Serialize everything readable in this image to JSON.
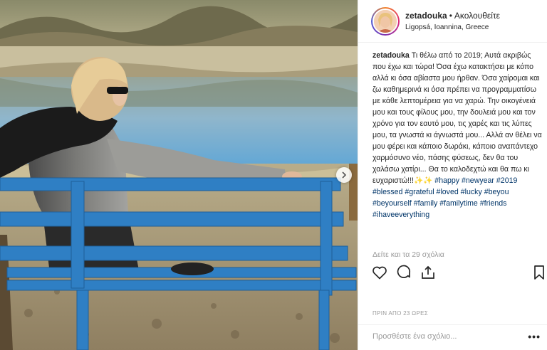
{
  "post": {
    "username": "zetadouka",
    "separator": "•",
    "follow_label": "Ακολουθείτε",
    "location": "Ligopsá, Ioannina, Greece",
    "caption": {
      "username": "zetadouka",
      "text": "Τι θέλω από το 2019; Αυτά ακριβώς που έχω και τώρα! Όσα έχω κατακτήσει με κόπο αλλά κι όσα αβίαστα μου ήρθαν. Όσα χαίρομαι και ζω καθημερινά κι όσα πρέπει να προγραμματίσω με κάθε λεπτομέρεια για να χαρώ. Την οικογένειά μου και τους φίλους μου, την δουλειά μου και τον χρόνο για τον εαυτό μου, τις χαρές και τις λύπες μου, τα γνωστά κι άγνωστά μου... Αλλά αν θέλει να μου φέρει και κάποιο δωράκι, κάποιο αναπάντεχο χαρμόσυνο νέο, πάσης φύσεως, δεν θα του χαλάσω χατίρι... Θα το καλοδεχτώ και θα πω κι ευχαριστώ!!!✨✨ ",
      "hashtags": [
        "#happy",
        "#newyear",
        "#2019",
        "#blessed",
        "#grateful",
        "#loved",
        "#lucky",
        "#beyou",
        "#beyourself",
        "#family",
        "#familytime",
        "#friends",
        "#ihaveeverything"
      ]
    },
    "view_comments": "Δείτε και τα 29 σχόλια",
    "timestamp": "ΠΡΙΝ ΑΠΟ 23 ΩΡΕΣ",
    "comment_placeholder": "Προσθέστε ένα σχόλιο...",
    "more_label": "•••"
  },
  "icons": [
    "heart-icon",
    "comment-icon",
    "share-icon",
    "bookmark-icon",
    "chevron-right-icon"
  ],
  "colors": {
    "text": "#262626",
    "hashtag": "#003569",
    "muted": "#999999",
    "border": "#efefef",
    "bench_blue": "#2f7fc4"
  }
}
